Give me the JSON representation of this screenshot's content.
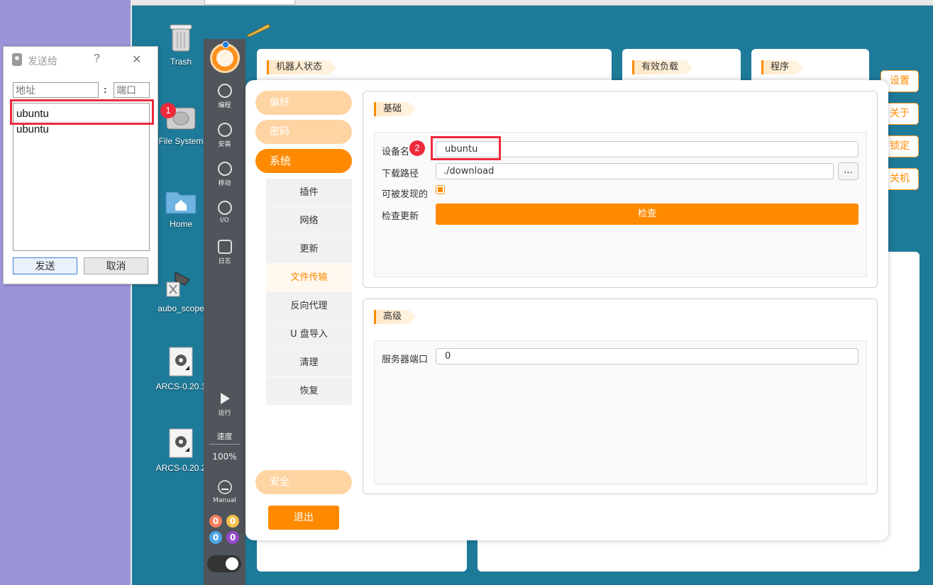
{
  "desktop": {
    "icons": [
      {
        "label": "Trash",
        "icon": "trash-icon"
      },
      {
        "label": "File System",
        "icon": "drive-icon"
      },
      {
        "label": "Home",
        "icon": "home-folder-icon"
      },
      {
        "label": "aubo_scope",
        "icon": "arm-shortcut-icon"
      },
      {
        "label": "ARCS-0.20.1",
        "icon": "gear-shortcut-icon"
      },
      {
        "label": "ARCS-0.20.2",
        "icon": "gear-shortcut-icon"
      }
    ]
  },
  "rail": {
    "items": [
      {
        "label": "编程",
        "icon": "check-circle-icon"
      },
      {
        "label": "安装",
        "icon": "gear-icon"
      },
      {
        "label": "移动",
        "icon": "move-icon"
      },
      {
        "label": "I/O",
        "icon": "io-icon"
      },
      {
        "label": "日志",
        "icon": "log-icon"
      }
    ],
    "run_label": "运行",
    "speed_label": "速度",
    "speed_value": "100%",
    "mode_label": "Manual",
    "counters": [
      "0",
      "0",
      "0",
      "0"
    ]
  },
  "background": {
    "panels": [
      "机器人状态",
      "有效负载",
      "程序"
    ],
    "side_buttons": [
      "设置",
      "关于",
      "锁定",
      "关机"
    ]
  },
  "settings": {
    "nav": [
      "偏好",
      "密码",
      "系统",
      "安全"
    ],
    "active_nav": "系统",
    "subnav": [
      "插件",
      "网络",
      "更新",
      "文件传输",
      "反向代理",
      "U 盘导入",
      "清理",
      "恢复"
    ],
    "selected_subnav": "文件传输",
    "exit_label": "退出",
    "basic": {
      "title": "基础",
      "device_name_label": "设备名",
      "device_name_value": "ubuntu",
      "download_path_label": "下载路径",
      "download_path_value": "./download",
      "browse_label": "...",
      "discoverable_label": "可被发现的",
      "discoverable": true,
      "check_update_label": "检查更新",
      "check_button": "检查"
    },
    "advanced": {
      "title": "高级",
      "server_port_label": "服务器端口",
      "server_port_value": "0"
    }
  },
  "dialog": {
    "title": "发送给",
    "help": "?",
    "close": "✕",
    "address_placeholder": "地址",
    "colon": ":",
    "port_placeholder": "端口",
    "list": [
      "ubuntu",
      "ubuntu"
    ],
    "send_label": "发送",
    "cancel_label": "取消"
  },
  "annotations": [
    "1",
    "2"
  ],
  "colors": {
    "accent": "#ff8a00",
    "accent_light": "#ffd4a3",
    "annotation": "#ee2a3b",
    "desktop": "#1d7a99"
  }
}
